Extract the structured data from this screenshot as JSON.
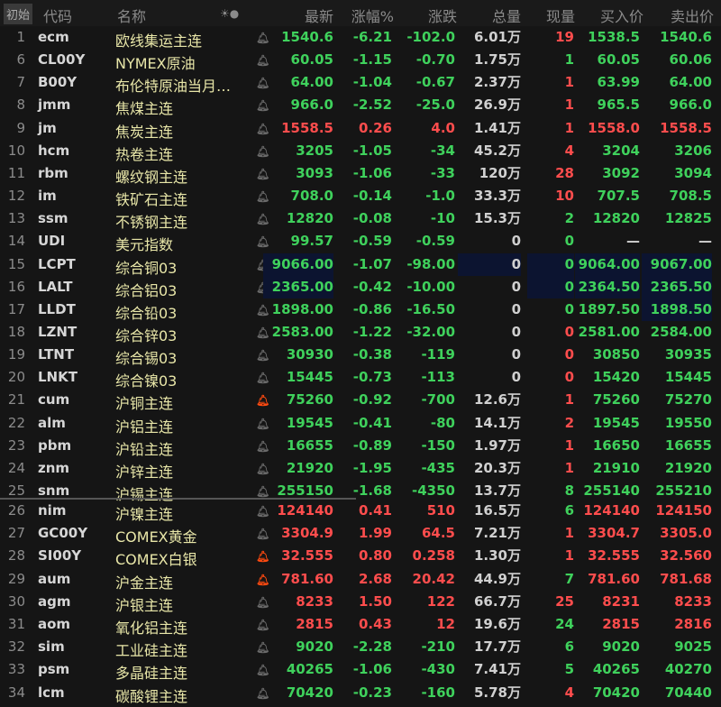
{
  "header": {
    "reset": "初始",
    "code": "代码",
    "name": "名称",
    "toggle": "☀●",
    "last": "最新",
    "pct": "涨幅%",
    "chg": "涨跌",
    "vol": "总量",
    "cur": "现量",
    "bid": "买入价",
    "ask": "卖出价"
  },
  "colors": {
    "up": "#ff4d4d",
    "down": "#3fd15c",
    "highlight": "#0c1430",
    "alert": "#ff4a10"
  },
  "rows": [
    {
      "idx": "1",
      "code": "ecm",
      "name": "欧线集运主连",
      "alert": false,
      "last": "1540.6",
      "pct": "-6.21",
      "chg": "-102.0",
      "vol": "6.01万",
      "cur": "19",
      "bid": "1538.5",
      "ask": "1540.6",
      "t": "down",
      "ct": "up"
    },
    {
      "idx": "6",
      "code": "CL00Y",
      "name": "NYMEX原油",
      "alert": false,
      "last": "60.05",
      "pct": "-1.15",
      "chg": "-0.70",
      "vol": "1.75万",
      "cur": "1",
      "bid": "60.05",
      "ask": "60.06",
      "t": "down",
      "ct": "down"
    },
    {
      "idx": "7",
      "code": "B00Y",
      "name": "布伦特原油当月…",
      "alert": false,
      "last": "64.00",
      "pct": "-1.04",
      "chg": "-0.67",
      "vol": "2.37万",
      "cur": "1",
      "bid": "63.99",
      "ask": "64.00",
      "t": "down",
      "ct": "up"
    },
    {
      "idx": "8",
      "code": "jmm",
      "name": "焦煤主连",
      "alert": false,
      "last": "966.0",
      "pct": "-2.52",
      "chg": "-25.0",
      "vol": "26.9万",
      "cur": "1",
      "bid": "965.5",
      "ask": "966.0",
      "t": "down",
      "ct": "up"
    },
    {
      "idx": "9",
      "code": "jm",
      "name": "焦炭主连",
      "alert": false,
      "last": "1558.5",
      "pct": "0.26",
      "chg": "4.0",
      "vol": "1.41万",
      "cur": "1",
      "bid": "1558.0",
      "ask": "1558.5",
      "t": "up",
      "ct": "up"
    },
    {
      "idx": "10",
      "code": "hcm",
      "name": "热卷主连",
      "alert": false,
      "last": "3205",
      "pct": "-1.05",
      "chg": "-34",
      "vol": "45.2万",
      "cur": "4",
      "bid": "3204",
      "ask": "3206",
      "t": "down",
      "ct": "up"
    },
    {
      "idx": "11",
      "code": "rbm",
      "name": "螺纹钢主连",
      "alert": false,
      "last": "3093",
      "pct": "-1.06",
      "chg": "-33",
      "vol": "120万",
      "cur": "28",
      "bid": "3092",
      "ask": "3094",
      "t": "down",
      "ct": "up"
    },
    {
      "idx": "12",
      "code": "im",
      "name": "铁矿石主连",
      "alert": false,
      "last": "708.0",
      "pct": "-0.14",
      "chg": "-1.0",
      "vol": "33.3万",
      "cur": "10",
      "bid": "707.5",
      "ask": "708.5",
      "t": "down",
      "ct": "up"
    },
    {
      "idx": "13",
      "code": "ssm",
      "name": "不锈钢主连",
      "alert": false,
      "last": "12820",
      "pct": "-0.08",
      "chg": "-10",
      "vol": "15.3万",
      "cur": "2",
      "bid": "12820",
      "ask": "12825",
      "t": "down",
      "ct": "down"
    },
    {
      "idx": "14",
      "code": "UDI",
      "name": "美元指数",
      "alert": false,
      "last": "99.57",
      "pct": "-0.59",
      "chg": "-0.59",
      "vol": "0",
      "cur": "0",
      "bid": "—",
      "ask": "—",
      "t": "down",
      "ct": "down"
    },
    {
      "idx": "15",
      "code": "LCPT",
      "name": "综合铜03",
      "alert": false,
      "last": "9066.00",
      "pct": "-1.07",
      "chg": "-98.00",
      "vol": "0",
      "cur": "0",
      "bid": "9064.00",
      "ask": "9067.00",
      "t": "down",
      "ct": "down",
      "hl": [
        "last",
        "vol",
        "cur",
        "bid",
        "ask"
      ]
    },
    {
      "idx": "16",
      "code": "LALT",
      "name": "综合铝03",
      "alert": false,
      "last": "2365.00",
      "pct": "-0.42",
      "chg": "-10.00",
      "vol": "0",
      "cur": "0",
      "bid": "2364.50",
      "ask": "2365.50",
      "t": "down",
      "ct": "down",
      "hl": [
        "last",
        "cur",
        "bid",
        "ask"
      ]
    },
    {
      "idx": "17",
      "code": "LLDT",
      "name": "综合铅03",
      "alert": false,
      "last": "1898.00",
      "pct": "-0.86",
      "chg": "-16.50",
      "vol": "0",
      "cur": "0",
      "bid": "1897.50",
      "ask": "1898.50",
      "t": "down",
      "ct": "down",
      "hl": [
        "ask"
      ]
    },
    {
      "idx": "18",
      "code": "LZNT",
      "name": "综合锌03",
      "alert": false,
      "last": "2583.00",
      "pct": "-1.22",
      "chg": "-32.00",
      "vol": "0",
      "cur": "0",
      "bid": "2581.00",
      "ask": "2584.00",
      "t": "down",
      "ct": "up"
    },
    {
      "idx": "19",
      "code": "LTNT",
      "name": "综合锡03",
      "alert": false,
      "last": "30930",
      "pct": "-0.38",
      "chg": "-119",
      "vol": "0",
      "cur": "0",
      "bid": "30850",
      "ask": "30935",
      "t": "down",
      "ct": "up"
    },
    {
      "idx": "20",
      "code": "LNKT",
      "name": "综合镍03",
      "alert": false,
      "last": "15445",
      "pct": "-0.73",
      "chg": "-113",
      "vol": "0",
      "cur": "0",
      "bid": "15420",
      "ask": "15445",
      "t": "down",
      "ct": "up"
    },
    {
      "idx": "21",
      "code": "cum",
      "name": "沪铜主连",
      "alert": true,
      "last": "75260",
      "pct": "-0.92",
      "chg": "-700",
      "vol": "12.6万",
      "cur": "1",
      "bid": "75260",
      "ask": "75270",
      "t": "down",
      "ct": "up"
    },
    {
      "idx": "22",
      "code": "alm",
      "name": "沪铝主连",
      "alert": false,
      "last": "19545",
      "pct": "-0.41",
      "chg": "-80",
      "vol": "14.1万",
      "cur": "2",
      "bid": "19545",
      "ask": "19550",
      "t": "down",
      "ct": "up"
    },
    {
      "idx": "23",
      "code": "pbm",
      "name": "沪铅主连",
      "alert": false,
      "last": "16655",
      "pct": "-0.89",
      "chg": "-150",
      "vol": "1.97万",
      "cur": "1",
      "bid": "16650",
      "ask": "16655",
      "t": "down",
      "ct": "up"
    },
    {
      "idx": "24",
      "code": "znm",
      "name": "沪锌主连",
      "alert": false,
      "last": "21920",
      "pct": "-1.95",
      "chg": "-435",
      "vol": "20.3万",
      "cur": "1",
      "bid": "21910",
      "ask": "21920",
      "t": "down",
      "ct": "up"
    },
    {
      "idx": "25",
      "code": "snm",
      "name": "沪锡主连",
      "alert": false,
      "last": "255150",
      "pct": "-1.68",
      "chg": "-4350",
      "vol": "13.7万",
      "cur": "8",
      "bid": "255140",
      "ask": "255210",
      "t": "down",
      "ct": "down"
    },
    {
      "idx": "26",
      "code": "nim",
      "name": "沪镍主连",
      "alert": false,
      "last": "124140",
      "pct": "0.41",
      "chg": "510",
      "vol": "16.5万",
      "cur": "6",
      "bid": "124140",
      "ask": "124150",
      "t": "up",
      "ct": "down"
    },
    {
      "idx": "27",
      "code": "GC00Y",
      "name": "COMEX黄金",
      "alert": false,
      "last": "3304.9",
      "pct": "1.99",
      "chg": "64.5",
      "vol": "7.21万",
      "cur": "1",
      "bid": "3304.7",
      "ask": "3305.0",
      "t": "up",
      "ct": "up"
    },
    {
      "idx": "28",
      "code": "SI00Y",
      "name": "COMEX白银",
      "alert": true,
      "last": "32.555",
      "pct": "0.80",
      "chg": "0.258",
      "vol": "1.30万",
      "cur": "1",
      "bid": "32.555",
      "ask": "32.560",
      "t": "up",
      "ct": "up"
    },
    {
      "idx": "29",
      "code": "aum",
      "name": "沪金主连",
      "alert": true,
      "last": "781.60",
      "pct": "2.68",
      "chg": "20.42",
      "vol": "44.9万",
      "cur": "7",
      "bid": "781.60",
      "ask": "781.68",
      "t": "up",
      "ct": "down"
    },
    {
      "idx": "30",
      "code": "agm",
      "name": "沪银主连",
      "alert": false,
      "last": "8233",
      "pct": "1.50",
      "chg": "122",
      "vol": "66.7万",
      "cur": "25",
      "bid": "8231",
      "ask": "8233",
      "t": "up",
      "ct": "up"
    },
    {
      "idx": "31",
      "code": "aom",
      "name": "氧化铝主连",
      "alert": false,
      "last": "2815",
      "pct": "0.43",
      "chg": "12",
      "vol": "19.6万",
      "cur": "24",
      "bid": "2815",
      "ask": "2816",
      "t": "up",
      "ct": "down"
    },
    {
      "idx": "32",
      "code": "sim",
      "name": "工业硅主连",
      "alert": false,
      "last": "9020",
      "pct": "-2.28",
      "chg": "-210",
      "vol": "17.7万",
      "cur": "6",
      "bid": "9020",
      "ask": "9025",
      "t": "down",
      "ct": "down"
    },
    {
      "idx": "33",
      "code": "psm",
      "name": "多晶硅主连",
      "alert": false,
      "last": "40265",
      "pct": "-1.06",
      "chg": "-430",
      "vol": "7.41万",
      "cur": "5",
      "bid": "40265",
      "ask": "40270",
      "t": "down",
      "ct": "down"
    },
    {
      "idx": "34",
      "code": "lcm",
      "name": "碳酸锂主连",
      "alert": false,
      "last": "70420",
      "pct": "-0.23",
      "chg": "-160",
      "vol": "5.78万",
      "cur": "4",
      "bid": "70420",
      "ask": "70440",
      "t": "down",
      "ct": "up"
    }
  ]
}
